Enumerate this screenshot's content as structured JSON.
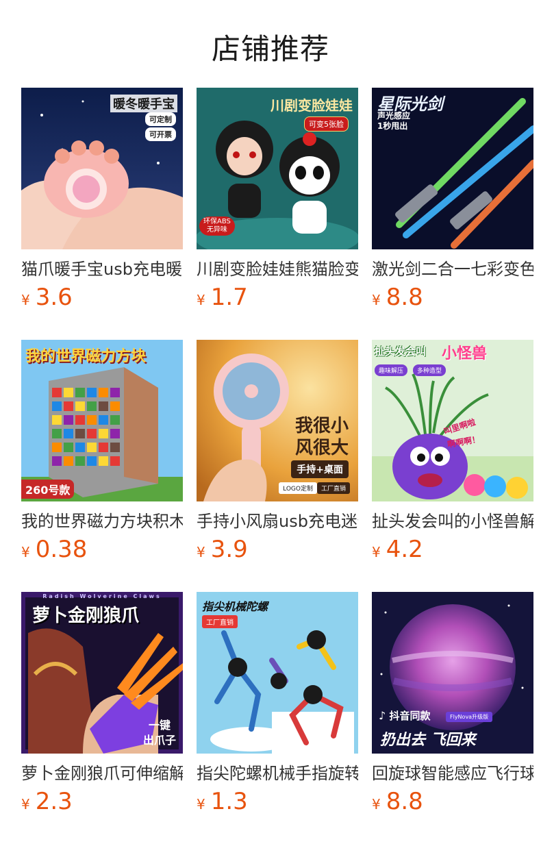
{
  "header": {
    "title": "店铺推荐"
  },
  "products": [
    {
      "name": "猫爪暖手宝usb充电暖手宝",
      "currency": "¥",
      "price": "3.6",
      "image": {
        "headline": "暖冬暖手宝",
        "tags": [
          "可定制",
          "可开票"
        ]
      }
    },
    {
      "name": "川剧变脸娃娃熊猫脸变脸",
      "currency": "¥",
      "price": "1.7",
      "image": {
        "headline": "川剧变脸娃娃",
        "tags": [
          "可变5张脸"
        ],
        "badge": [
          "环保ABS",
          "无异味"
        ]
      }
    },
    {
      "name": "激光剑二合一七彩变色光剑",
      "currency": "¥",
      "price": "8.8",
      "image": {
        "headline": "星际光剑",
        "sub": [
          "声光感应",
          "1秒甩出"
        ]
      }
    },
    {
      "name": "我的世界磁力方块积木",
      "currency": "¥",
      "price": "0.38",
      "image": {
        "headline": "我的世界磁力方块",
        "badge": "260号款"
      }
    },
    {
      "name": "手持小风扇usb充电迷你",
      "currency": "¥",
      "price": "3.9",
      "image": {
        "lines": [
          "我很小",
          "风很大"
        ],
        "badge": "手持+桌面",
        "tags": [
          "LOGO定制",
          "工厂直销"
        ]
      }
    },
    {
      "name": "扯头发会叫的小怪兽解压",
      "currency": "¥",
      "price": "4.2",
      "image": {
        "headline": "扯头发会叫",
        "headline2": "小怪兽",
        "tags": [
          "趣味解压",
          "多种造型"
        ],
        "shout": [
          "叫里啊啦",
          "啊啊啊！"
        ]
      }
    },
    {
      "name": "萝卜金刚狼爪可伸缩解压",
      "currency": "¥",
      "price": "2.3",
      "image": {
        "topline": "Radish Wolverine Claws",
        "headline": "萝卜金刚狼爪",
        "corner": [
          "一键",
          "出爪子"
        ]
      }
    },
    {
      "name": "指尖陀螺机械手指旋转",
      "currency": "¥",
      "price": "1.3",
      "image": {
        "headline": "指尖机械陀螺",
        "tag": "工厂直销"
      }
    },
    {
      "name": "回旋球智能感应飞行球",
      "currency": "¥",
      "price": "8.8",
      "image": {
        "brand": "抖音同款",
        "tag": "FlyNova升级版",
        "slogan": "扔出去 飞回来"
      }
    }
  ],
  "colors": {
    "price": "#e8530e",
    "title": "#1a1a1a",
    "name": "#333333"
  }
}
